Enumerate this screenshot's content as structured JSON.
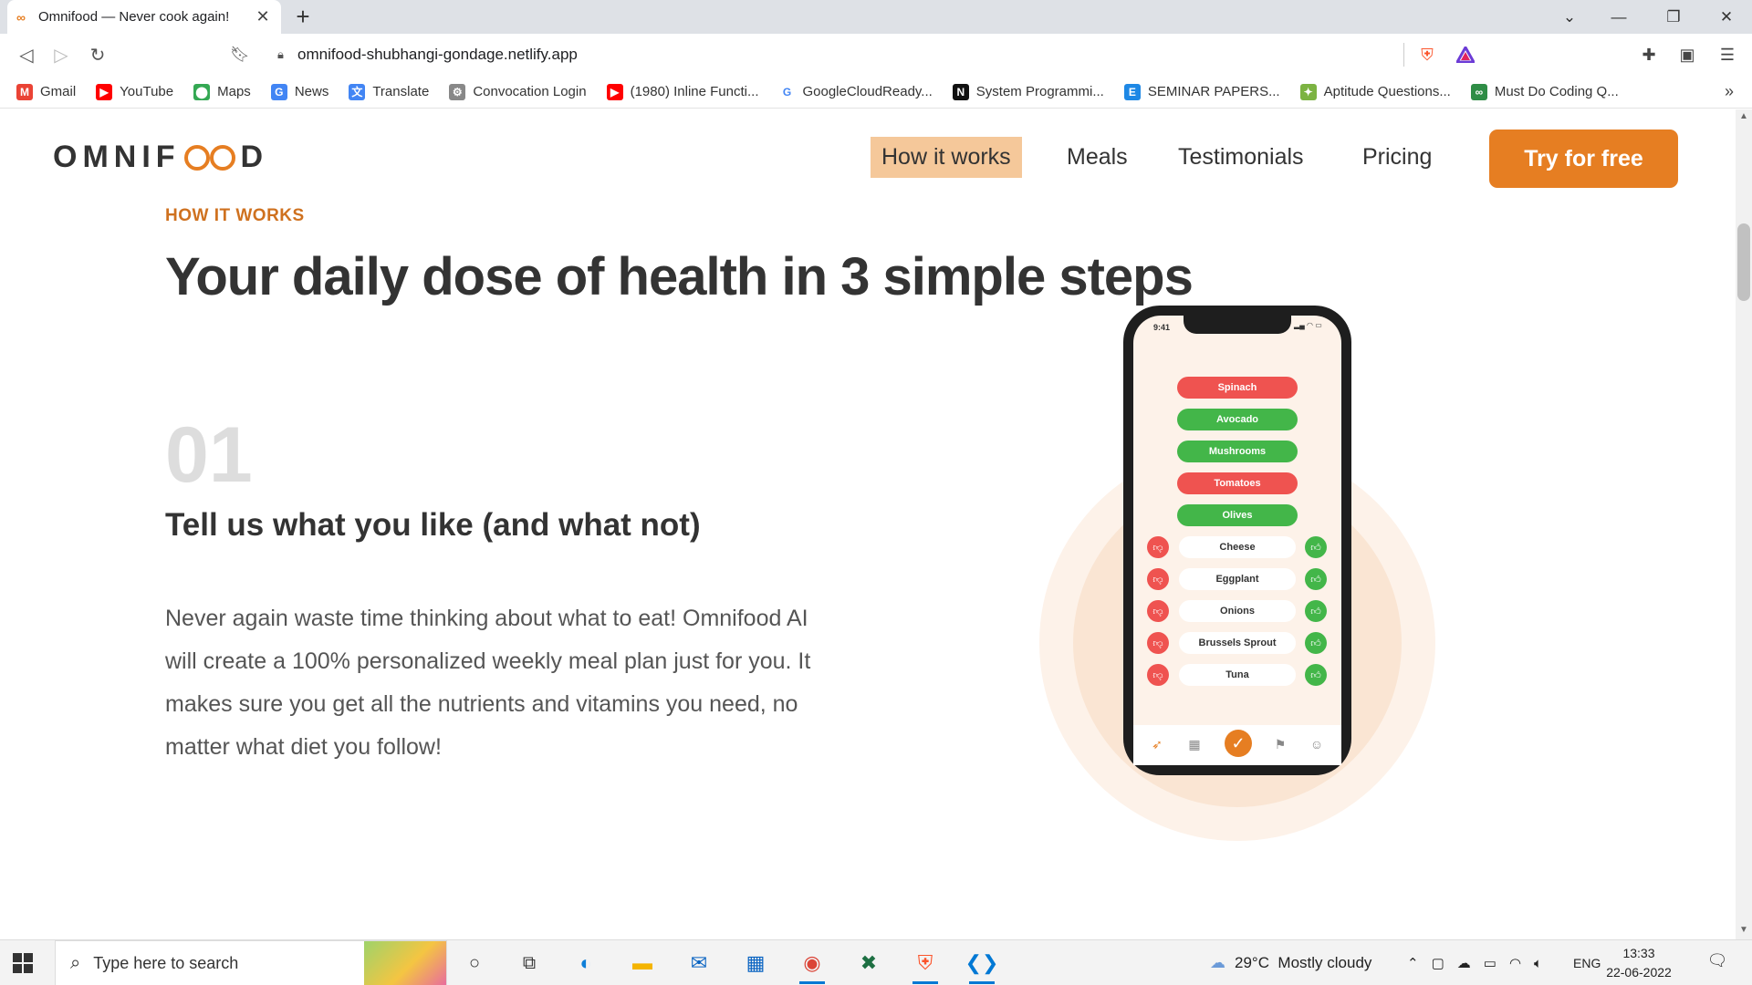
{
  "browser": {
    "tab_title": "Omnifood — Never cook again!",
    "tab_favicon": "∞",
    "url": "omnifood-shubhangi-gondage.netlify.app",
    "bookmarks": [
      {
        "label": "Gmail",
        "icon": "gmail-icon",
        "color": "#ea4335",
        "glyph": "M"
      },
      {
        "label": "YouTube",
        "icon": "youtube-icon",
        "color": "#ff0000",
        "glyph": "▶"
      },
      {
        "label": "Maps",
        "icon": "maps-icon",
        "color": "#34a853",
        "glyph": "⬤"
      },
      {
        "label": "News",
        "icon": "news-icon",
        "color": "#4285f4",
        "glyph": "G"
      },
      {
        "label": "Translate",
        "icon": "translate-icon",
        "color": "#4285f4",
        "glyph": "文"
      },
      {
        "label": "Convocation Login",
        "icon": "convocation-icon",
        "color": "#888888",
        "glyph": "⚙"
      },
      {
        "label": "(1980) Inline Functi...",
        "icon": "youtube-icon",
        "color": "#ff0000",
        "glyph": "▶"
      },
      {
        "label": "GoogleCloudReady...",
        "icon": "google-icon",
        "color": "#ffffff",
        "glyph": "G"
      },
      {
        "label": "System Programmi...",
        "icon": "notion-icon",
        "color": "#111111",
        "glyph": "N"
      },
      {
        "label": "SEMINAR PAPERS...",
        "icon": "seminar-icon",
        "color": "#1e88e5",
        "glyph": "E"
      },
      {
        "label": "Aptitude Questions...",
        "icon": "aptitude-icon",
        "color": "#7cb342",
        "glyph": "✦"
      },
      {
        "label": "Must Do Coding Q...",
        "icon": "gfg-icon",
        "color": "#2f8d46",
        "glyph": "∞"
      }
    ]
  },
  "nav": {
    "logo_left": "OMNIF",
    "logo_right": "D",
    "links": [
      "How it works",
      "Meals",
      "Testimonials",
      "Pricing"
    ],
    "cta": "Try for free"
  },
  "section": {
    "subheading": "HOW IT WORKS",
    "heading": "Your daily dose of health in 3 simple steps",
    "step_number": "01",
    "step_title": "Tell us what you like (and what not)",
    "step_text": "Never again waste time thinking about what to eat! Omnifood AI will create a 100% personalized weekly meal plan just for you. It makes sure you get all the nutrients and vitamins you need, no matter what diet you follow!"
  },
  "phone": {
    "time": "9:41",
    "pills": [
      {
        "label": "Spinach",
        "state": "red"
      },
      {
        "label": "Avocado",
        "state": "green"
      },
      {
        "label": "Mushrooms",
        "state": "green"
      },
      {
        "label": "Tomatoes",
        "state": "red"
      },
      {
        "label": "Olives",
        "state": "green"
      }
    ],
    "rows": [
      "Cheese",
      "Eggplant",
      "Onions",
      "Brussels Sprout",
      "Tuna"
    ]
  },
  "taskbar": {
    "search_placeholder": "Type here to search",
    "weather": "29°C  Mostly cloudy",
    "lang": "ENG",
    "time": "13:33",
    "date": "22-06-2022"
  },
  "colors": {
    "accent": "#e67e22",
    "nav_highlight": "#f5c89a",
    "pill_red": "#ef5350",
    "pill_green": "#43b649"
  }
}
